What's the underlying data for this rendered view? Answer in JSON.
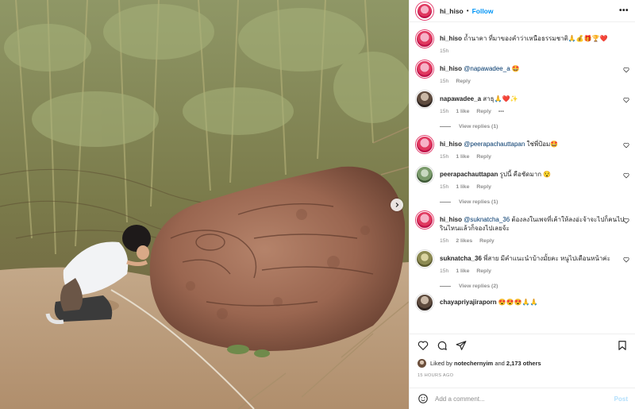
{
  "post": {
    "author": "hi_hiso",
    "follow_label": "Follow",
    "separator": "•",
    "more_label": "•••"
  },
  "comments": [
    {
      "user": "hi_hiso",
      "text": "ถ้ำนาคา ที่มาของคำว่าเหนือธรรมชาติ🙏💰🎁🏆❤️",
      "mention": "",
      "time": "15h",
      "likes": "",
      "reply": "",
      "view_replies": "",
      "avatar": "pink",
      "heart": false
    },
    {
      "user": "hi_hiso",
      "mention": "@napawadee_a",
      "text": " 🤩",
      "time": "15h",
      "likes": "",
      "reply": "Reply",
      "view_replies": "",
      "avatar": "pink",
      "heart": true
    },
    {
      "user": "napawadee_a",
      "mention": "",
      "text": "สาธุ🙏❤️✨",
      "time": "15h",
      "likes": "1 like",
      "reply": "Reply",
      "view_replies": "View replies (1)",
      "avatar": "gray",
      "heart": true,
      "dots": "•••"
    },
    {
      "user": "hi_hiso",
      "mention": "@peerapachauttapan",
      "text": " ใช่พี่ป้อม🤩",
      "time": "15h",
      "likes": "1 like",
      "reply": "Reply",
      "view_replies": "",
      "avatar": "pink",
      "heart": true
    },
    {
      "user": "peerapachauttapan",
      "mention": "",
      "text": "รูปนี้ คือชัดมาก 😯",
      "time": "15h",
      "likes": "1 like",
      "reply": "Reply",
      "view_replies": "View replies (1)",
      "avatar": "green",
      "heart": true
    },
    {
      "user": "hi_hiso",
      "mention": "@suknatcha_36",
      "text": " ต้องลงในเพจที่เค้าให้ลงอ่ะจ้าจะไปก็คนไปรินไหนแล้วก็จองไปเลยจ้ะ",
      "time": "15h",
      "likes": "2 likes",
      "reply": "Reply",
      "view_replies": "",
      "avatar": "pink",
      "heart": true
    },
    {
      "user": "suknatcha_36",
      "mention": "",
      "text": "พี่สาย มีคำแนะนำบ้างมั้ยคะ หนูไปเดือนหน้าค่ะ",
      "time": "15h",
      "likes": "1 like",
      "reply": "Reply",
      "view_replies": "View replies (2)",
      "avatar": "olive",
      "heart": true
    },
    {
      "user": "chayapriyajiraporn",
      "mention": "",
      "text": "😍😍😍🙏🙏",
      "time": "",
      "likes": "",
      "reply": "",
      "view_replies": "",
      "avatar": "gray",
      "heart": false
    }
  ],
  "likes": {
    "prefix": "Liked by",
    "user": "notechernyim",
    "and": "and",
    "others": "2,173 others"
  },
  "time_ago": "15 HOURS AGO",
  "add_comment": {
    "placeholder": "Add a comment...",
    "post_label": "Post"
  },
  "icons": {
    "like": "heart-icon",
    "comment": "comment-icon",
    "share": "share-icon",
    "save": "bookmark-icon",
    "emoji": "emoji-icon",
    "next": "chevron-right-icon"
  },
  "colors": {
    "link_blue": "#0095f6",
    "mention": "#00376b",
    "muted": "#8e8e8e",
    "post_disabled": "#b2dffc"
  }
}
